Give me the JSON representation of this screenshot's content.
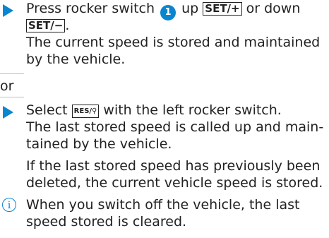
{
  "step1": {
    "line1_pre": "Press rocker switch ",
    "line1_num": "1",
    "line1_mid": " up ",
    "key_set_plus": "SET/+",
    "line1_post": " or down",
    "key_set_minus": "SET/−",
    "line2_post": ".",
    "line3": "The current speed is stored and maintained",
    "line4": "by the vehicle."
  },
  "or_label": "or",
  "step2": {
    "line1_pre": "Select ",
    "key_res": "RES/⚲",
    "line1_post": " with the left rocker switch.",
    "line2": "The last stored speed is called up and main-",
    "line3": "tained by the vehicle.",
    "line4": "If the last stored speed has previously been",
    "line5": "deleted, the current vehicle speed is stored."
  },
  "note": {
    "icon_glyph": "i",
    "line1": "When you switch off the vehicle, the last",
    "line2": "speed stored is cleared."
  },
  "colors": {
    "accent": "#0a85cf",
    "text": "#222222"
  }
}
